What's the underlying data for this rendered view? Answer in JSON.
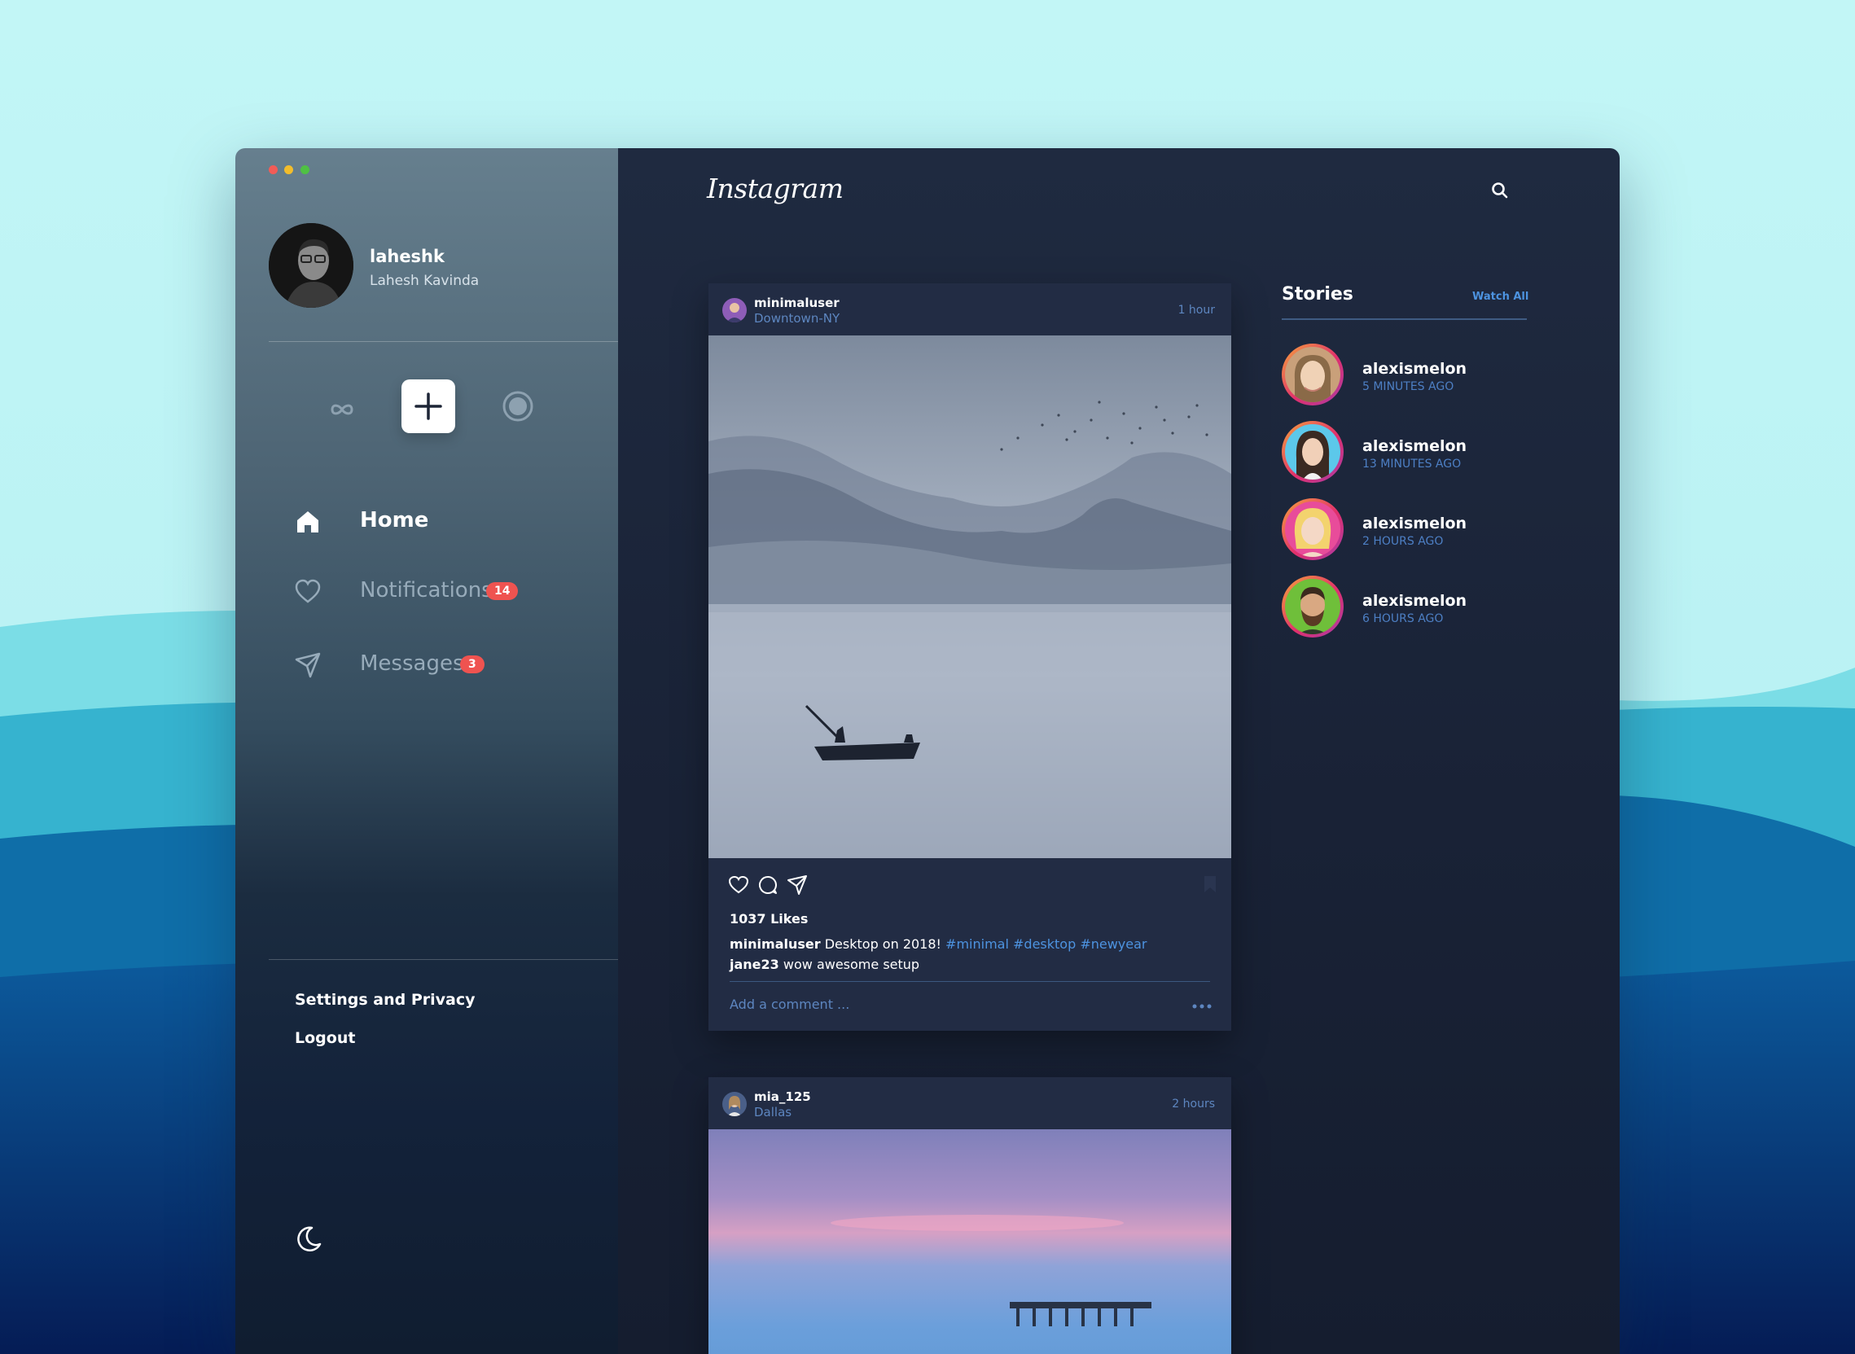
{
  "window": {
    "controls": [
      "close",
      "minimize",
      "zoom"
    ]
  },
  "profile": {
    "username": "laheshk",
    "full_name": "Lahesh Kavinda"
  },
  "quick_actions": [
    {
      "icon": "infinity-icon"
    },
    {
      "icon": "plus-icon"
    },
    {
      "icon": "record-icon"
    }
  ],
  "nav": {
    "home": {
      "label": "Home",
      "icon": "home-icon"
    },
    "notifications": {
      "label": "Notifications",
      "badge": "14",
      "icon": "heart-icon"
    },
    "messages": {
      "label": "Messages",
      "badge": "3",
      "icon": "send-icon"
    }
  },
  "footer": {
    "settings": "Settings and Privacy",
    "logout": "Logout",
    "theme_icon": "moon-icon"
  },
  "header": {
    "logo": "Instagram",
    "search_icon": "search-icon"
  },
  "posts": [
    {
      "user": "minimaluser",
      "location": "Downtown-NY",
      "time": "1 hour",
      "likes": "1037 Likes",
      "caption_user": "minimaluser",
      "caption_text": "Desktop on 2018!",
      "tags": [
        "#minimal",
        "#desktop",
        "#newyear"
      ],
      "comment_user": "jane23",
      "comment_text": "wow awesome setup",
      "add_comment": "Add a comment ..."
    },
    {
      "user": "mia_125",
      "location": "Dallas",
      "time": "2 hours"
    }
  ],
  "stories": {
    "title": "Stories",
    "watch_all": "Watch All",
    "items": [
      {
        "name": "alexismelon",
        "time": "5 MINUTES AGO"
      },
      {
        "name": "alexismelon",
        "time": "13 MINUTES AGO"
      },
      {
        "name": "alexismelon",
        "time": "2 HOURS AGO"
      },
      {
        "name": "alexismelon",
        "time": "6 HOURS AGO"
      }
    ]
  },
  "colors": {
    "accent": "#4d93e0",
    "badge": "#ef5350",
    "panel": "#222c44",
    "background": "#192236"
  }
}
